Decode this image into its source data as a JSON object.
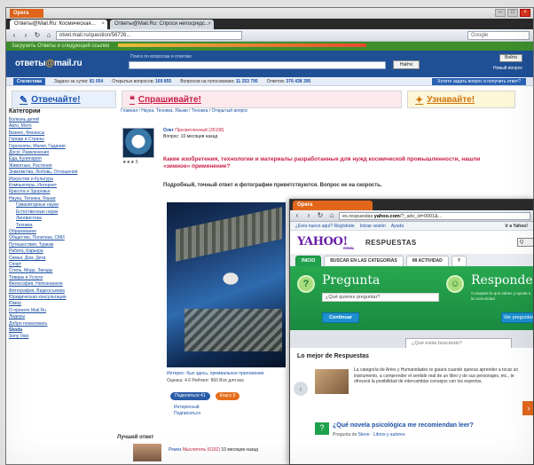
{
  "back_browser": {
    "app_button": "Opera",
    "tabs": [
      {
        "label": "Ответы@Mail.Ru: Космическая...",
        "active": true
      },
      {
        "label": "Ответы@Mail.Ru: Спроси непосредс...",
        "active": false
      }
    ],
    "url": "otvet.mail.ru/question/56726...",
    "search_placeholder": "Google",
    "bookmarks_text": "Загрузить Ответы и следующий ссылки"
  },
  "otvety": {
    "logo_main": "ответы",
    "logo_at": "@",
    "logo_domain": "mail.ru",
    "search_label": "Поиск по вопросам и ответам",
    "find_button": "Найти",
    "login_button": "Войти",
    "new_question_link": "Новый вопрос",
    "stats": {
      "title": "Статистика",
      "items": [
        {
          "label": "Задано за сутки:",
          "value": "81 054"
        },
        {
          "label": "Открытых вопросов:",
          "value": "169 855"
        },
        {
          "label": "Вопросов на голосовании:",
          "value": "11 253 795"
        },
        {
          "label": "Ответов:",
          "value": "376 438 395"
        }
      ],
      "promo": "Хотите задать вопрос и получить ответ?"
    },
    "promo": {
      "answer": "Отвечайте!",
      "ask": "Спрашивайте!",
      "learn": "Узнавайте!"
    },
    "categories_title": "Категории",
    "categories": [
      {
        "label": "Болезнь детей",
        "sub": false
      },
      {
        "label": "Авто, Мото",
        "sub": false
      },
      {
        "label": "Бизнес, Финансы",
        "sub": false
      },
      {
        "label": "Города и Страны",
        "sub": false
      },
      {
        "label": "Гороскопы, Магия, Гадания",
        "sub": false
      },
      {
        "label": "Досуг, Развлечения",
        "sub": false
      },
      {
        "label": "Еда, Кулинария",
        "sub": false
      },
      {
        "label": "Животные, Растения",
        "sub": false
      },
      {
        "label": "Знакомства, Любовь, Отношения",
        "sub": false
      },
      {
        "label": "Искусство и Культура",
        "sub": false
      },
      {
        "label": "Компьютеры, Интернет",
        "sub": false
      },
      {
        "label": "Красота и Здоровье",
        "sub": false
      },
      {
        "label": "Наука, Техника, Языки",
        "sub": false
      },
      {
        "label": "Гуманитарные науки",
        "sub": true
      },
      {
        "label": "Естественные науки",
        "sub": true
      },
      {
        "label": "Лингвистика",
        "sub": true
      },
      {
        "label": "Техника",
        "sub": true
      },
      {
        "label": "Образование",
        "sub": false
      },
      {
        "label": "Общество, Политика, СМИ",
        "sub": false
      },
      {
        "label": "Путешествия, Туризм",
        "sub": false
      },
      {
        "label": "Работа, Карьера",
        "sub": false
      },
      {
        "label": "Семья, Дом, Дети",
        "sub": false
      },
      {
        "label": "Спорт",
        "sub": false
      },
      {
        "label": "Стиль, Мода, Звезды",
        "sub": false
      },
      {
        "label": "Товары и Услуги",
        "sub": false
      },
      {
        "label": "Философия, Непознанное",
        "sub": false
      },
      {
        "label": "Фотография, Видеосъемка",
        "sub": false
      },
      {
        "label": "Юридическая консультация",
        "sub": false
      },
      {
        "label": "Юмор",
        "sub": false
      },
      {
        "label": "О проекте Mail.Ru",
        "sub": false
      },
      {
        "label": "Лидеры",
        "sub": false
      },
      {
        "label": "Добро пожаловать",
        "sub": false
      },
      {
        "label": "Skoda",
        "sub": false,
        "bold": true
      },
      {
        "label": "Sony Vaio",
        "sub": false
      }
    ],
    "breadcrumb": "Главная / Наука, Техника, Языки / Техника / Открытый вопрос",
    "question": {
      "user": "Олег",
      "user_rank": "Просветленный (25108)",
      "user_since": "Вопрос: 10 месяцев назад",
      "avatar_meta": "5",
      "title": "Какие изобретения, технологии и материалы разработанные для нужд космической промышленности, нашли «земное» применение?",
      "body": "Подробный, точный ответ и фотографии приветствуются. Вопрос не на скорость.",
      "photo_caption": "Интерес: был здесь, премиальное приложение",
      "photo_stats": "Оценка: 4.6  Рейтинг: 860  Всё для вас"
    },
    "share": {
      "share_label": "Поделиться",
      "share_count": "41",
      "like_label": "Класс",
      "like_count": "5"
    },
    "interesting_links": [
      "Интересный",
      "Подписаться"
    ],
    "best_answer_title": "Лучший ответ",
    "best_answer_user": "Ремиз",
    "best_answer_rank": "Мыслитель (6192)",
    "best_answer_meta": "10 месяцев назад"
  },
  "front_browser": {
    "tab_label": "Opera",
    "url_prefix": "es.respuestas.",
    "url_domain": "yahoo.com",
    "url_rest": "/?_adv_id=0001&..."
  },
  "yahoo": {
    "topnav": [
      "¿Eres nuevo aquí? Regístrate",
      "Iniciar sesión",
      "Ayuda"
    ],
    "topnav_right": "Ir a Yahoo!",
    "logo": "YAHOO!",
    "logo_sub": "ESPAÑA",
    "brand": "RESPUESTAS",
    "search_button": "Q",
    "tabs": [
      {
        "label": "INICIO",
        "active": true
      },
      {
        "label": "BUSCAR EN LAS CATEGORÍAS",
        "active": false
      },
      {
        "label": "MI ACTIVIDAD",
        "active": false
      },
      {
        "label": "Y",
        "active": false
      }
    ],
    "hero": {
      "ask_title": "Pregunta",
      "ask_placeholder": "¿Qué quieres preguntar?",
      "continue_button": "Continuar",
      "answer_title": "Responde",
      "answer_text": "Comparte lo que sabes y ayuda a la comunidad",
      "see_more_button": "Ver preguntas"
    },
    "search_placeholder": "¿Qué estás buscando?",
    "best": {
      "title": "Lo mejor de Respuestas",
      "text": "La categoría de Artes y Humanidades te guiará cuando quieras aprender a tocar un instrumento, a comprender el sentido real de un libro y de sus personajes, etc., te ofrecerá la posibilidad de intercambiar consejos con los expertos.",
      "related_question": "¿Qué novela psicológica me recomiendan leer?",
      "related_meta_prefix": "Pregunta de",
      "related_user": "Steve",
      "related_meta_sep": "·",
      "related_category": "Libros y autores"
    }
  }
}
